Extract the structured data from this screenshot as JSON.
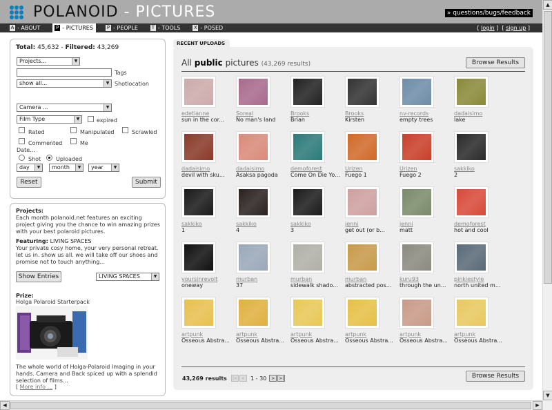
{
  "header": {
    "brand_a": "POLANOID",
    "brand_b": " - PICTURES",
    "feedback": "» questions/bugs/feedback"
  },
  "nav": [
    {
      "key": "A",
      "label": "- ABOUT"
    },
    {
      "key": "P",
      "label": "- PICTURES"
    },
    {
      "key": "P",
      "label": "- PEOPLE"
    },
    {
      "key": "T",
      "label": "- TOOLS"
    },
    {
      "key": "X",
      "label": "- POSED"
    }
  ],
  "auth": {
    "login": "login",
    "signup": "sign up"
  },
  "filters": {
    "total_label": "Total:",
    "total": "45,632",
    "filtered_label": "Filtered:",
    "filtered": "43,269",
    "projects": "Projects...",
    "tags": "Tags",
    "show": "show all...",
    "shotlocation": "Shotlocation",
    "camera": "Camera ...",
    "filmtype": "Film Type",
    "expired": "expired",
    "rated": "Rated",
    "manipulated": "Manipulated",
    "scrawled": "Scrawled",
    "commented": "Commented",
    "me": "Me",
    "date": "Date...",
    "shot": "Shot",
    "uploaded": "Uploaded",
    "day": "day",
    "month": "month",
    "year": "year",
    "reset": "Reset",
    "submit": "Submit"
  },
  "info": {
    "projects_h": "Projects:",
    "projects_t": "Each month polanoid.net features an exciting project giving you the chance to win amazing prizes with your best polaroid pictures.",
    "featuring_h": "Featuring:",
    "featuring_v": "LIVING SPACES",
    "featuring_t": "Your private cosy home, your very personal retreat. let us in. show us all. we will take off our shoes and promise not to touch anything...",
    "show_entries": "Show Entries",
    "select": "LIVING SPACES",
    "prize_h": "Prize:",
    "prize_v": "Holga Polaroid Starterpack",
    "prize_t": "The whole world of Holga-Polaroid Imaging in your hands. Camera and Back spiced up with a splendid selection of films...",
    "more": "More info ..."
  },
  "main": {
    "tab": "RECENT UPLOADS",
    "title_a": "All ",
    "title_b": "public",
    "title_c": " pictures ",
    "count": "(43,269 results)",
    "browse": "Browse Results",
    "footer_count": "43,269 results",
    "page": "1 - 30"
  },
  "photos": [
    {
      "user": "edetianne",
      "caption": "sun in the cor...",
      "color": "#caa"
    },
    {
      "user": "Soreal",
      "caption": "No man's land",
      "color": "#a86b8c"
    },
    {
      "user": "Brooks",
      "caption": "Brian",
      "color": "#222"
    },
    {
      "user": "Brooks",
      "caption": "Kirsten",
      "color": "#333"
    },
    {
      "user": "nv-records",
      "caption": "empty trees",
      "color": "#6e8da8"
    },
    {
      "user": "dadaisimo",
      "caption": "lake",
      "color": "#8a8a3a"
    },
    {
      "user": "dadaisimo",
      "caption": "devil with sku...",
      "color": "#8a3a2a"
    },
    {
      "user": "dadaisimo",
      "caption": "Asaksa pagoda",
      "color": "#d98a7a"
    },
    {
      "user": "demoforest",
      "caption": "Come On Die Yo...",
      "color": "#2d7a7a"
    },
    {
      "user": "Urizen",
      "caption": "Fuego 1",
      "color": "#d06a2a"
    },
    {
      "user": "Urizen",
      "caption": "Fuego 2",
      "color": "#c8402a"
    },
    {
      "user": "sakkiko",
      "caption": "2",
      "color": "#2a2a2a"
    },
    {
      "user": "sakkiko",
      "caption": "1",
      "color": "#1a1a1a"
    },
    {
      "user": "sakkiko",
      "caption": "4",
      "color": "#2a2220"
    },
    {
      "user": "sakkiko",
      "caption": "3",
      "color": "#1c1c1c"
    },
    {
      "user": "jenni",
      "caption": "get out (or b...",
      "color": "#cfa0a0"
    },
    {
      "user": "jenni",
      "caption": "matt",
      "color": "#7a8a6a"
    },
    {
      "user": "demoforest",
      "caption": "hot and cool",
      "color": "#d84a3a"
    },
    {
      "user": "yoursinrevolt",
      "caption": "oneway",
      "color": "#111"
    },
    {
      "user": "murban",
      "caption": "37",
      "color": "#9aa8b8"
    },
    {
      "user": "murban",
      "caption": "sidewalk shado...",
      "color": "#b0b0a8"
    },
    {
      "user": "murban",
      "caption": "abstracted pos...",
      "color": "#c89a4a"
    },
    {
      "user": "kuru93",
      "caption": "through the un...",
      "color": "#8a8a80"
    },
    {
      "user": "pinkiestyle",
      "caption": "north united m...",
      "color": "#5a6a78"
    },
    {
      "user": "artpunk",
      "caption": "Osseous Abstra...",
      "color": "#e8c050"
    },
    {
      "user": "artpunk",
      "caption": "Osseous Abstra...",
      "color": "#e0b040"
    },
    {
      "user": "artpunk",
      "caption": "Osseous Abstra...",
      "color": "#e8c858"
    },
    {
      "user": "artpunk",
      "caption": "Osseous Abstra...",
      "color": "#e6c048"
    },
    {
      "user": "artpunk",
      "caption": "Osseous Abstra...",
      "color": "#c89a88"
    },
    {
      "user": "artpunk",
      "caption": "Osseous Abstra...",
      "color": "#e8c860"
    }
  ]
}
